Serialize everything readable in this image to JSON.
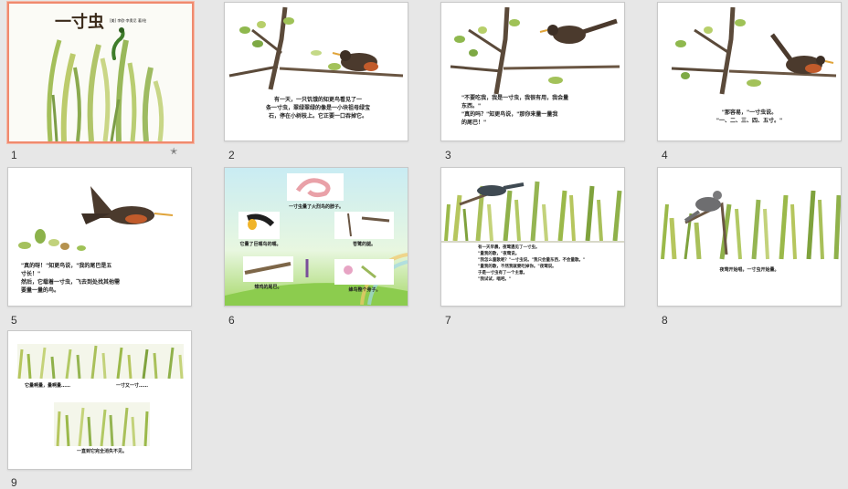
{
  "slides": [
    {
      "number": "1",
      "title": "一寸虫",
      "author": "[美] 李欧·李奥尼 著/绘",
      "has_star": true
    },
    {
      "number": "2",
      "text": "有一天，一只饥饿的知更鸟看见了一\n条一寸虫，翠绿翠绿的像是一小块祖母绿宝\n石，停在小树枝上。它正要一口吞掉它。"
    },
    {
      "number": "3",
      "text": "\"不要吃我，我是一寸虫，我很有用，我会量\n东西。\"\n\"真的吗？\"知更鸟说，\"那你来量一量我\n的尾巴！\""
    },
    {
      "number": "4",
      "text": "\"那容易，\"一寸虫说。\n\"一、二、三、四、五寸。\""
    },
    {
      "number": "5",
      "text": "\"真的呀！\"知更鸟说，\"我的尾巴是五\n寸长！\"\n然后，它载着一寸虫，飞去到处找其他需\n要量一量的鸟。"
    },
    {
      "number": "6",
      "top": "一寸虫量了火烈鸟的脖子。",
      "left1": "它量了巨嘴鸟的嘴。",
      "right1": "苍鹭的腿。",
      "left2": "雉鸡的尾巴。",
      "right2": "蜂鸟整个身子。"
    },
    {
      "number": "7",
      "text": "有一天早晨，夜莺遇见了一寸虫。\n\"量我的歌，\"夜莺说。\n\"我怎么量歌呢？\"一寸虫说。\"我只会量东西，不会量歌。\"\n\"量我的歌，不然我就要吃掉你。\"夜莺说。\n于是一寸虫有了一个主意。\n\"我试试，唱吧。\""
    },
    {
      "number": "8",
      "text": "夜莺开始唱，一寸虫开始量。"
    },
    {
      "number": "9",
      "left": "它量啊量，量啊量……",
      "right": "一寸又一寸……",
      "bottom": "一直到它完全消失不见。"
    }
  ]
}
